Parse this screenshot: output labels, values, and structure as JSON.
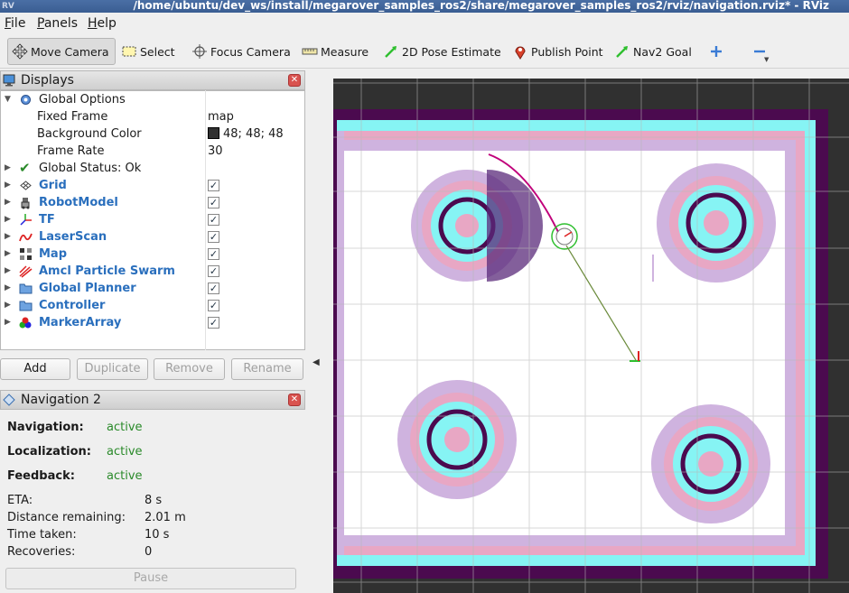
{
  "window": {
    "title": "/home/ubuntu/dev_ws/install/megarover_samples_ros2/share/megarover_samples_ros2/rviz/navigation.rviz* - RViz",
    "app_icon": "rviz-icon"
  },
  "menubar": {
    "items": [
      {
        "label": "File",
        "accel": "F"
      },
      {
        "label": "Panels",
        "accel": "P"
      },
      {
        "label": "Help",
        "accel": "H"
      }
    ]
  },
  "toolbar": {
    "move_camera": "Move Camera",
    "select": "Select",
    "focus_camera": "Focus Camera",
    "measure": "Measure",
    "pose_estimate": "2D Pose Estimate",
    "publish_point": "Publish Point",
    "nav2_goal": "Nav2 Goal"
  },
  "displays": {
    "title": "Displays",
    "global_options": "Global Options",
    "fixed_frame_label": "Fixed Frame",
    "fixed_frame_value": "map",
    "bg_color_label": "Background Color",
    "bg_color_value": "48; 48; 48",
    "bg_color_hex": "#303030",
    "frame_rate_label": "Frame Rate",
    "frame_rate_value": "30",
    "global_status": "Global Status: Ok",
    "items": [
      {
        "label": "Grid",
        "icon": "grid-icon",
        "checked": true
      },
      {
        "label": "RobotModel",
        "icon": "robot-model-icon",
        "checked": true
      },
      {
        "label": "TF",
        "icon": "tf-icon",
        "checked": true
      },
      {
        "label": "LaserScan",
        "icon": "laserscan-icon",
        "checked": true
      },
      {
        "label": "Map",
        "icon": "map-icon",
        "checked": true
      },
      {
        "label": "Amcl Particle Swarm",
        "icon": "particle-swarm-icon",
        "checked": true
      },
      {
        "label": "Global Planner",
        "icon": "folder-icon",
        "checked": true
      },
      {
        "label": "Controller",
        "icon": "folder-icon",
        "checked": true
      },
      {
        "label": "MarkerArray",
        "icon": "marker-array-icon",
        "checked": true
      }
    ],
    "buttons": {
      "add": "Add",
      "duplicate": "Duplicate",
      "remove": "Remove",
      "rename": "Rename"
    }
  },
  "navigation": {
    "title": "Navigation 2",
    "navigation_label": "Navigation:",
    "navigation_value": "active",
    "localization_label": "Localization:",
    "localization_value": "active",
    "feedback_label": "Feedback:",
    "feedback_value": "active",
    "eta_label": "ETA:",
    "eta_value": "8 s",
    "distance_label": "Distance remaining:",
    "distance_value": "2.01 m",
    "time_label": "Time taken:",
    "time_value": "10 s",
    "recoveries_label": "Recoveries:",
    "recoveries_value": "0",
    "pause_button": "Pause"
  },
  "colors": {
    "status_active": "#2a8a2a",
    "tree_label_blue": "#2a6fbd",
    "costmap_pink": "#e8a7c4",
    "costmap_cyan": "#86f4f4",
    "costmap_lavender": "#cfb3df",
    "obstacle_purple": "#4b0a4f"
  }
}
